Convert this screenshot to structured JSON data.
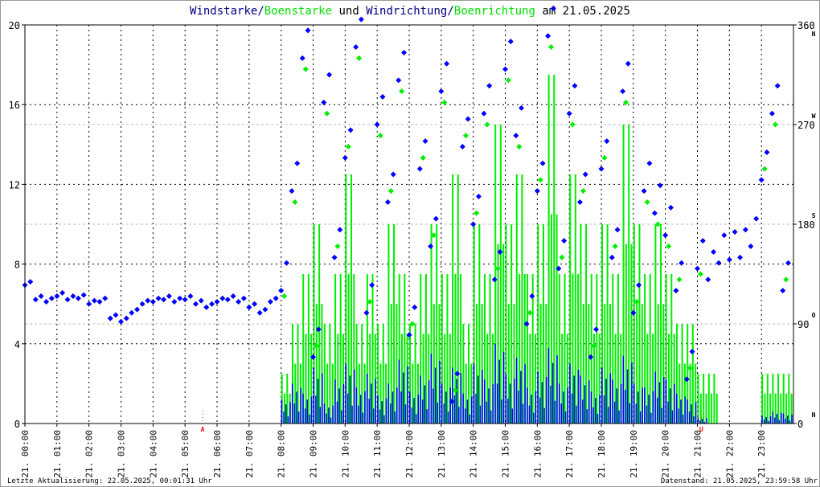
{
  "title_parts": [
    {
      "text": "Windstarke",
      "color": "#000080"
    },
    {
      "text": "/",
      "color": "#000080"
    },
    {
      "text": "Boenstarke",
      "color": "#00e000"
    },
    {
      "text": " und ",
      "color": "#000000"
    },
    {
      "text": "Windrichtung",
      "color": "#000080"
    },
    {
      "text": "/",
      "color": "#000080"
    },
    {
      "text": "Boenrichtung",
      "color": "#00e000"
    },
    {
      "text": " am 21.05.2025",
      "color": "#000000"
    }
  ],
  "footer": {
    "left": "Letzte Aktualisierung: 22.05.2025, 00:01:31 Uhr",
    "right": "Datenstand: 21.05.2025, 23:59:58 Uhr"
  },
  "chart_data": {
    "type": "bar+scatter",
    "title": "Windstarke/Boenstarke und Windrichtung/Boenrichtung am 21.05.2025",
    "x_range_hours": [
      0,
      24
    ],
    "x_step_hours": 0.3333,
    "x_tick_labels": [
      "21. 00:00",
      "21. 01:00",
      "21. 02:00",
      "21. 03:00",
      "21. 04:00",
      "21. 05:00",
      "21. 06:00",
      "21. 07:00",
      "21. 08:00",
      "21. 09:00",
      "21. 10:00",
      "21. 11:00",
      "21. 12:00",
      "21. 13:00",
      "21. 14:00",
      "21. 15:00",
      "21. 16:00",
      "21. 17:00",
      "21. 18:00",
      "21. 19:00",
      "21. 20:00",
      "21. 21:00",
      "21. 22:00",
      "21. 23:00"
    ],
    "y_left": {
      "range": [
        0,
        20
      ],
      "ticks": [
        "0",
        "4",
        "8",
        "12",
        "16",
        "20"
      ]
    },
    "y_right": {
      "range": [
        0,
        360
      ],
      "ticks": [
        "0",
        "90",
        "180",
        "270",
        "360"
      ],
      "compass": [
        "N",
        "O",
        "S",
        "W",
        "N"
      ]
    },
    "annotations": [
      {
        "label": "A",
        "hour": 5.55,
        "color": "#ff0000"
      },
      {
        "label": "U",
        "hour": 21.12,
        "color": "#ff0000"
      }
    ],
    "colors": {
      "wind": "#0000ff",
      "gust": "#00ee00"
    },
    "series": [
      {
        "name": "Windstarke",
        "axis": "left",
        "kind": "bar",
        "values": [
          0,
          0,
          0,
          0,
          0,
          0,
          0,
          0,
          0,
          0,
          0,
          0,
          0,
          0,
          0,
          0,
          0,
          0,
          0,
          0,
          0,
          0,
          0,
          0,
          1.2,
          2.0,
          1.5,
          2.8,
          1.0,
          2.2,
          3.0,
          1.8,
          2.5,
          1.4,
          2.0,
          3.2,
          1.6,
          2.4,
          3.5,
          2.0,
          2.8,
          1.5,
          3.0,
          2.2,
          4.0,
          2.5,
          3.3,
          1.8,
          2.6,
          3.8,
          2.0,
          3.0,
          2.4,
          1.6,
          2.8,
          2.2,
          3.4,
          2.0,
          1.8,
          2.6,
          2.2,
          1.5,
          1.2,
          0.3,
          0,
          0,
          0,
          0,
          0,
          0.4,
          0.6,
          0.5
        ]
      },
      {
        "name": "Boenstarke",
        "axis": "left",
        "kind": "bar",
        "values": [
          0,
          0,
          0,
          0,
          0,
          0,
          0,
          0,
          0,
          0,
          0,
          0,
          0,
          0,
          0,
          0,
          0,
          0,
          0,
          0,
          0,
          0,
          0,
          0,
          2.5,
          5,
          7.5,
          10,
          5,
          7.5,
          12.5,
          5,
          7.5,
          5,
          10,
          7.5,
          5,
          7.5,
          10,
          7.5,
          12.5,
          5,
          10,
          7.5,
          15,
          10,
          12.5,
          7.5,
          10,
          17.5,
          7.5,
          12.5,
          10,
          7.5,
          10,
          7.5,
          15,
          10,
          7.5,
          10,
          7.5,
          5,
          5,
          2.5,
          2.5,
          0,
          0,
          0,
          0,
          2.5,
          2.5,
          2.5
        ]
      },
      {
        "name": "Windrichtung",
        "axis": "right",
        "kind": "scatter",
        "values": [
          125,
          112,
          110,
          115,
          112,
          113,
          108,
          110,
          95,
          92,
          100,
          108,
          110,
          112,
          110,
          112,
          108,
          105,
          110,
          112,
          110,
          105,
          100,
          110,
          120,
          210,
          330,
          60,
          290,
          150,
          240,
          340,
          100,
          270,
          200,
          310,
          80,
          230,
          160,
          300,
          20,
          250,
          180,
          280,
          130,
          320,
          260,
          90,
          210,
          350,
          140,
          280,
          200,
          60,
          230,
          150,
          300,
          100,
          210,
          190,
          170,
          120,
          40,
          140,
          130,
          145,
          148,
          150,
          160,
          220,
          280,
          120
        ]
      },
      {
        "name": "Boenrichtung",
        "axis": "right",
        "kind": "scatter",
        "values": [
          null,
          null,
          null,
          null,
          null,
          null,
          null,
          null,
          null,
          null,
          null,
          null,
          null,
          null,
          null,
          null,
          null,
          null,
          null,
          null,
          null,
          null,
          null,
          null,
          115,
          200,
          320,
          70,
          280,
          160,
          250,
          330,
          110,
          260,
          210,
          300,
          90,
          240,
          170,
          290,
          30,
          260,
          190,
          270,
          140,
          310,
          250,
          100,
          220,
          340,
          150,
          270,
          210,
          70,
          240,
          160,
          290,
          110,
          200,
          180,
          160,
          130,
          50,
          135,
          null,
          null,
          null,
          null,
          null,
          230,
          270,
          130
        ]
      }
    ]
  }
}
